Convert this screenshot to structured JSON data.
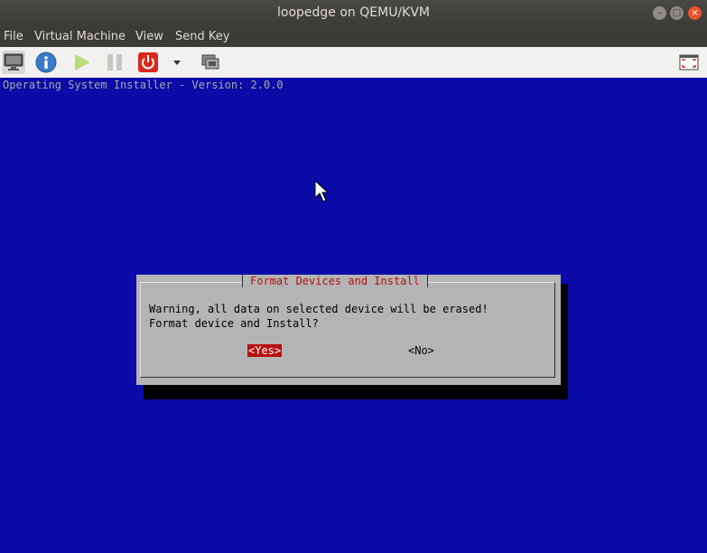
{
  "window": {
    "title": "loopedge on QEMU/KVM",
    "controls": {
      "minimize": "–",
      "maximize": "□",
      "close": "×"
    }
  },
  "menubar": {
    "items": [
      "File",
      "Virtual Machine",
      "View",
      "Send Key"
    ]
  },
  "toolbar": {
    "buttons": [
      {
        "name": "console-icon"
      },
      {
        "name": "info-icon"
      },
      {
        "name": "play-icon"
      },
      {
        "name": "pause-icon"
      },
      {
        "name": "power-icon"
      },
      {
        "name": "dropdown-icon"
      },
      {
        "name": "snapshot-icon"
      },
      {
        "name": "fullscreen-icon"
      }
    ],
    "colors": {
      "info": "#3a7ac9",
      "play": "#8fce2d",
      "power": "#d9281d"
    }
  },
  "vm": {
    "installer_title": "Operating System Installer - Version: 2.0.0",
    "dialog": {
      "title": "Format Devices and Install",
      "message_line1": "Warning, all data on selected device will be erased!",
      "message_line2": "Format device and Install?",
      "yes_label": "<Yes>",
      "no_label": "<No>"
    },
    "colors": {
      "background": "#0b0ba8",
      "dialog": "#b4b4b4",
      "accent": "#b81010"
    }
  }
}
